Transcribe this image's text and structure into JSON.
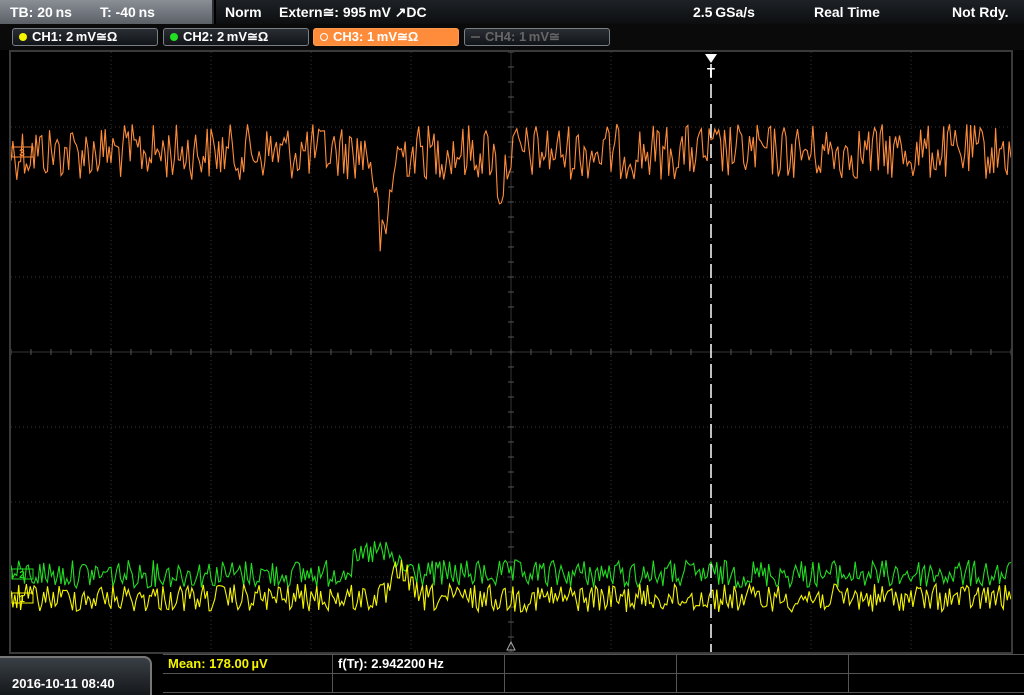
{
  "status": {
    "timebase": "TB: 20 ns",
    "trigger_time": "T: -40 ns",
    "acq_mode": "Norm",
    "trigger_source": "Extern≅: 995 mV ↗DC",
    "sample_rate": "2.5 GSa/s",
    "acq_type": "Real Time",
    "trigger_state": "Not Rdy."
  },
  "channels": [
    {
      "label": "CH1: 2 mV≅Ω",
      "color": "#f5f500",
      "enabled": true
    },
    {
      "label": "CH2: 2 mV≅Ω",
      "color": "#22dd22",
      "enabled": true
    },
    {
      "label": "CH3: 1 mV≅Ω",
      "color": "#ff8c3a",
      "enabled": true,
      "active": true
    },
    {
      "label": "CH4: 1 mV≅",
      "color": "#555555",
      "enabled": false
    }
  ],
  "markers": {
    "ch3": "3",
    "ch2": "2",
    "ch1": "1",
    "trigger": "T"
  },
  "measurements": {
    "mean": "Mean: 178.00 µV",
    "frequency": "f(Tr): 2.942200 Hz"
  },
  "datetime": "2016-10-11 08:40",
  "colors": {
    "ch1": "#f5f500",
    "ch2": "#22dd22",
    "ch3": "#ff8c3a",
    "grid": "#3c3c3c",
    "mean_label": "#f5f500"
  }
}
